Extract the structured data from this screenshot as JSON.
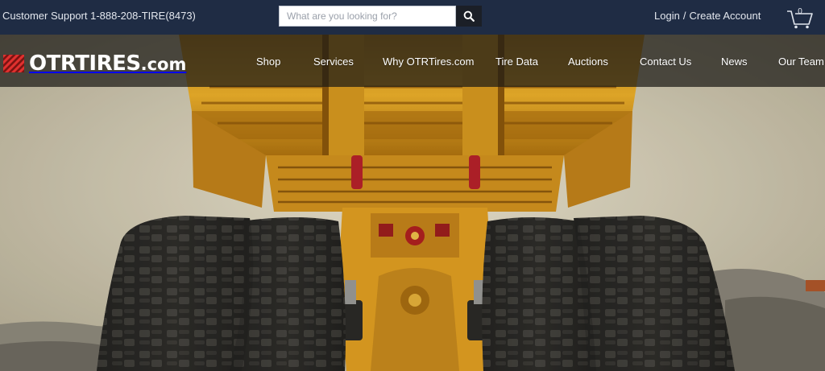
{
  "topbar": {
    "support_text": "Customer Support 1-888-208-TIRE(8473)",
    "search_placeholder": "What are you looking for?",
    "login_label": "Login",
    "separator": "/",
    "create_account_label": "Create Account",
    "cart_count": "0"
  },
  "brand": {
    "name": "OTRTIRES",
    "suffix": ".com"
  },
  "nav": {
    "items": [
      {
        "label": "Shop"
      },
      {
        "label": "Services"
      },
      {
        "label": "Why OTRTires.com"
      },
      {
        "label": "Tire Data"
      },
      {
        "label": "Auctions"
      },
      {
        "label": "Contact Us"
      },
      {
        "label": "News"
      },
      {
        "label": "Our Team"
      }
    ]
  },
  "colors": {
    "topbar_bg": "#1f2c44",
    "brand_red": "#e0312f",
    "truck_yellow": "#e8a21a"
  },
  "icons": {
    "search": "search-icon",
    "cart": "cart-icon",
    "logo_mark": "logo-stripes-icon"
  }
}
